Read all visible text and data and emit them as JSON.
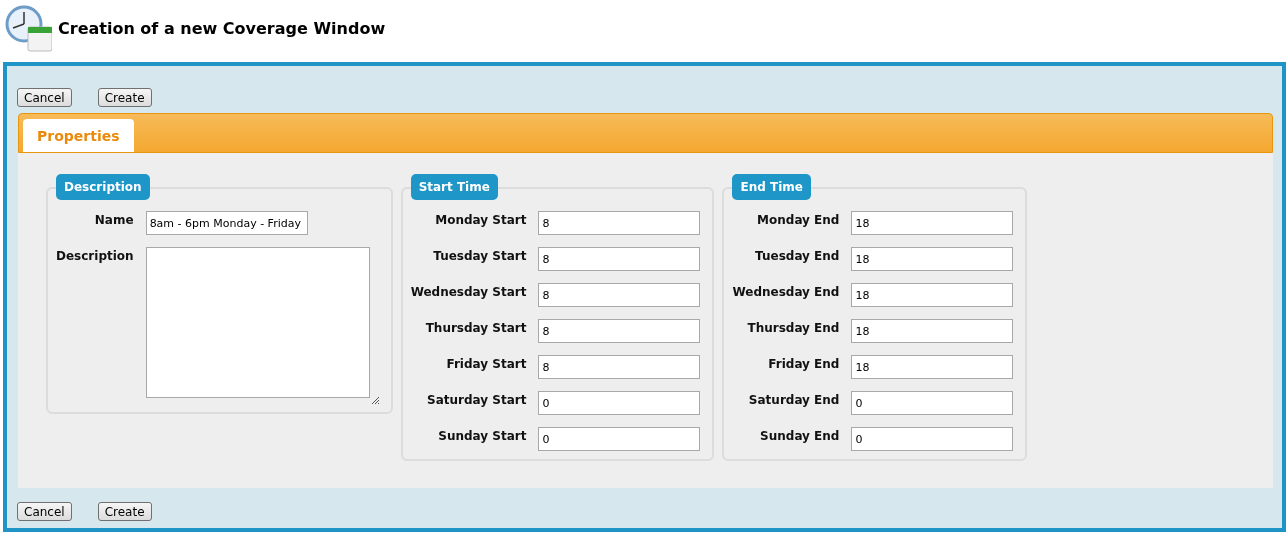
{
  "page": {
    "title": "Creation of a new Coverage Window"
  },
  "top_buttons": [
    {
      "label": "Cancel"
    },
    {
      "label": "Create"
    }
  ],
  "tabs": [
    {
      "label": "Properties",
      "selected": true
    }
  ],
  "groups": [
    {
      "legend": "Description",
      "fields": [
        {
          "kind": "text",
          "label": "Name",
          "value": "8am - 6pm Monday - Friday"
        },
        {
          "kind": "textarea",
          "label": "Description"
        }
      ]
    },
    {
      "legend": "Start Time",
      "fields": [
        {
          "kind": "text",
          "label": "Monday Start",
          "value": "8"
        },
        {
          "kind": "text",
          "label": "Tuesday Start",
          "value": "8"
        },
        {
          "kind": "text",
          "label": "Wednesday Start",
          "value": "8"
        },
        {
          "kind": "text",
          "label": "Thursday Start",
          "value": "8"
        },
        {
          "kind": "text",
          "label": "Friday Start",
          "value": "8"
        },
        {
          "kind": "text",
          "label": "Saturday Start",
          "value": "0"
        },
        {
          "kind": "text",
          "label": "Sunday Start",
          "value": "0"
        }
      ]
    },
    {
      "legend": "End Time",
      "fields": [
        {
          "kind": "text",
          "label": "Monday End",
          "value": "18"
        },
        {
          "kind": "text",
          "label": "Tuesday End",
          "value": "18"
        },
        {
          "kind": "text",
          "label": "Wednesday End",
          "value": "18"
        },
        {
          "kind": "text",
          "label": "Thursday End",
          "value": "18"
        },
        {
          "kind": "text",
          "label": "Friday End",
          "value": "18"
        },
        {
          "kind": "text",
          "label": "Saturday End",
          "value": "0"
        },
        {
          "kind": "text",
          "label": "Sunday End",
          "value": "0"
        }
      ]
    }
  ],
  "bottom_buttons": [
    {
      "label": "Cancel"
    },
    {
      "label": "Create"
    }
  ]
}
